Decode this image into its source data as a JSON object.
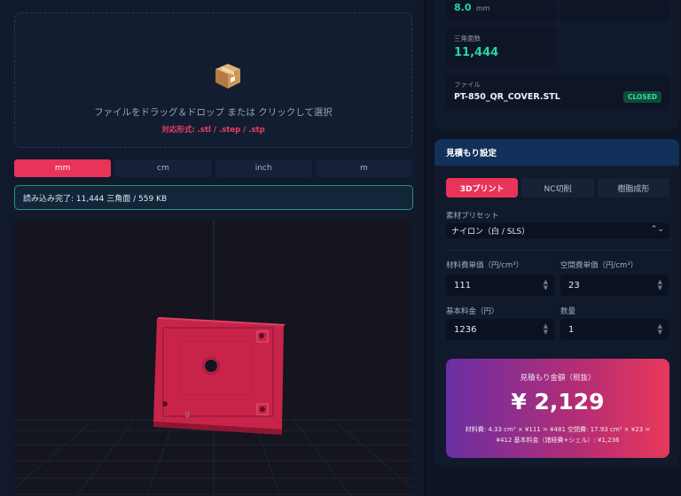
{
  "upload": {
    "icon": "package-icon",
    "instruction": "ファイルをドラッグ＆ドロップ または クリックして選択",
    "formats": "対応形式: .stl / .step / .stp"
  },
  "units": [
    {
      "label": "mm",
      "active": true
    },
    {
      "label": "cm",
      "active": false
    },
    {
      "label": "inch",
      "active": false
    },
    {
      "label": "m",
      "active": false
    }
  ],
  "status": "読み込み完了: 11,444 三角面 / 559 KB",
  "viewer": {
    "origin_label": "0",
    "model_color": "#d6294f"
  },
  "stats": {
    "height_value": "8.0",
    "height_unit": "mm",
    "triangles_label": "三角面数",
    "triangles_value": "11,444",
    "file_label": "ファイル",
    "file_name": "PT-850_QR_COVER.STL",
    "file_badge": "CLOSED"
  },
  "estimate": {
    "header": "見積もり設定",
    "methods": [
      {
        "label": "3Dプリント",
        "active": true
      },
      {
        "label": "NC切削",
        "active": false
      },
      {
        "label": "樹脂成形",
        "active": false
      }
    ],
    "preset_label": "素材プリセット",
    "preset_value": "ナイロン（白 / SLS）",
    "material_cost_label": "材料費単価（円/cm³）",
    "material_cost_value": "111",
    "space_cost_label": "空間費単価（円/cm³）",
    "space_cost_value": "23",
    "base_fee_label": "基本料金（円）",
    "base_fee_value": "1236",
    "quantity_label": "数量",
    "quantity_value": "1"
  },
  "quote": {
    "title": "見積もり金額（税抜）",
    "value": "¥ 2,129",
    "breakdown": "材料費: 4.33 cm³ × ¥111 = ¥481 空間費: 17.93 cm³ × ¥23 = ¥412 基本料金（諸経費+シェル）: ¥1,236"
  },
  "colors": {
    "accent": "#ea3359",
    "success": "#27d4a0",
    "status_border": "#2e8f7c",
    "header_blue": "#12305a"
  }
}
